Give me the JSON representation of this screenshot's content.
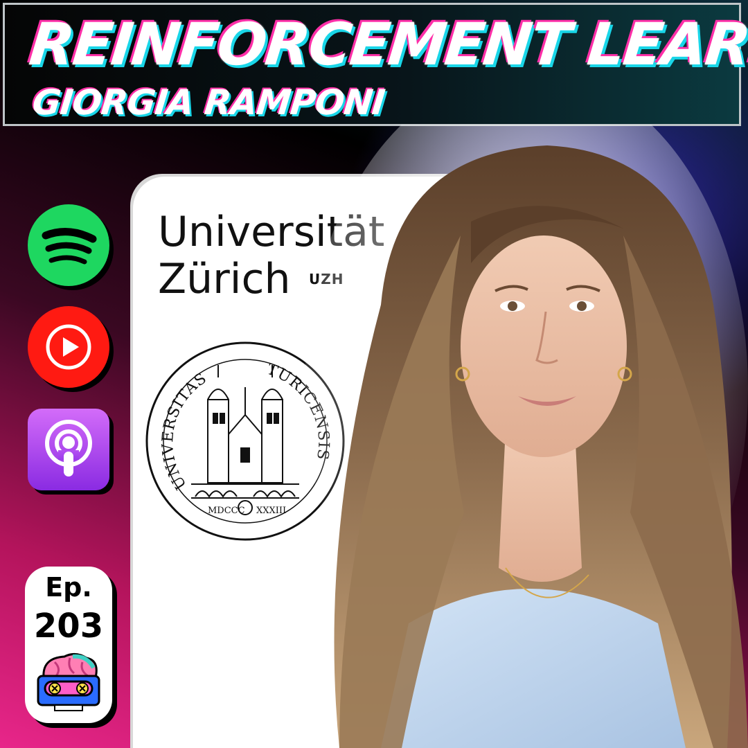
{
  "banner": {
    "title": "REINFORCEMENT LEARNING",
    "guest": "GIORGIA RAMPONI"
  },
  "platforms": [
    {
      "name": "Spotify",
      "icon": "spotify-icon",
      "color": "#1ed760"
    },
    {
      "name": "YouTube",
      "icon": "youtube-play-icon",
      "color": "#ff1a12"
    },
    {
      "name": "Apple Podcasts",
      "icon": "podcasts-icon",
      "color": "#a93df0"
    }
  ],
  "episode": {
    "label": "Ep.",
    "number": "203",
    "mascot_icon": "brain-cassette-icon"
  },
  "university": {
    "line1": "Universität",
    "line2": "Zürich",
    "tag": "UZH",
    "seal_text_left": "UNIVERSITAS",
    "seal_text_right": "TURICENSIS",
    "seal_year_left": "MDCCC",
    "seal_year_right": "XXXIII"
  },
  "colors": {
    "accent_pink": "#ff2fa8",
    "accent_cyan": "#19d6e8",
    "background_magenta": "#e8268a"
  }
}
